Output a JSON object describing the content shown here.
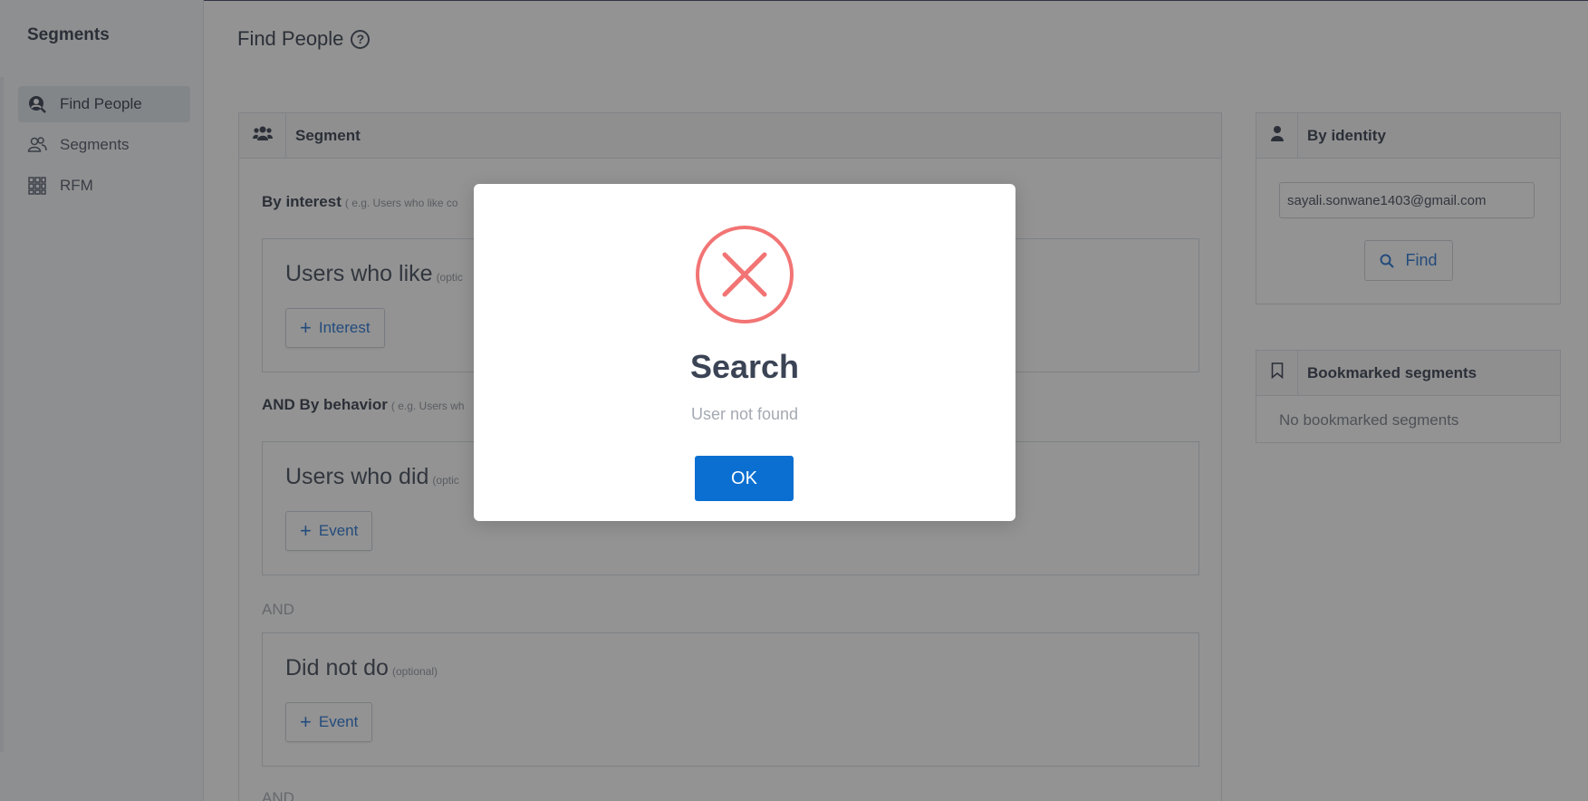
{
  "sidebar": {
    "title": "Segments",
    "items": [
      {
        "label": "Find People",
        "icon": "user-search-icon",
        "active": true
      },
      {
        "label": "Segments",
        "icon": "users-icon",
        "active": false
      },
      {
        "label": "RFM",
        "icon": "grid-icon",
        "active": false
      }
    ]
  },
  "header": {
    "title": "Find People",
    "help": "?"
  },
  "segment": {
    "title": "Segment",
    "by_interest": {
      "label": "By interest",
      "hint": "( e.g. Users who like co"
    },
    "users_who_like": {
      "title": "Users who like",
      "optional": "(optic",
      "button": "Interest"
    },
    "by_behavior": {
      "label": "AND By behavior",
      "hint": "( e.g. Users wh"
    },
    "users_who_did": {
      "title": "Users who did",
      "optional": "(optic",
      "button": "Event"
    },
    "and_1": "AND",
    "did_not_do": {
      "title": "Did not do",
      "optional": "(optional)",
      "button": "Event"
    },
    "and_2": "AND"
  },
  "identity": {
    "title": "By identity",
    "input_value": "sayali.sonwane1403@gmail.com",
    "find_label": "Find"
  },
  "bookmarks": {
    "title": "Bookmarked segments",
    "empty": "No bookmarked segments"
  },
  "modal": {
    "title": "Search",
    "message": "User not found",
    "ok_label": "OK",
    "icon": "error-x-icon"
  },
  "colors": {
    "accent": "#0a6fd1",
    "error": "#f27474",
    "link": "#1f6fd0"
  }
}
